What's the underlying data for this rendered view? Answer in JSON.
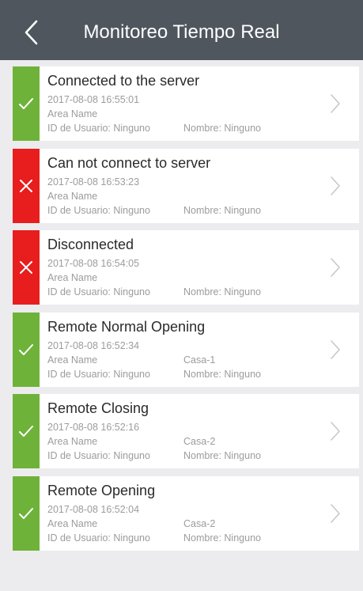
{
  "header": {
    "title": "Monitoreo Tiempo Real"
  },
  "icons": {
    "back": "chevron-left-icon",
    "ok": "check-icon",
    "error": "x-icon",
    "open": "chevron-right-icon"
  },
  "colors": {
    "header_bg": "#4f565e",
    "success": "#6fb23a",
    "error": "#e81d1d",
    "background": "#ececee"
  },
  "events": [
    {
      "status": "ok",
      "title": "Connected to the server",
      "time": "2017-08-08 16:55:01",
      "area_label": "Area Name",
      "area_value": "",
      "user": "ID de Usuario: Ninguno",
      "name": "Nombre: Ninguno"
    },
    {
      "status": "err",
      "title": "Can not connect to server",
      "time": "2017-08-08 16:53:23",
      "area_label": "Area Name",
      "area_value": "",
      "user": "ID de Usuario: Ninguno",
      "name": "Nombre: Ninguno"
    },
    {
      "status": "err",
      "title": "Disconnected",
      "time": "2017-08-08 16:54:05",
      "area_label": "Area Name",
      "area_value": "",
      "user": "ID de Usuario: Ninguno",
      "name": "Nombre: Ninguno"
    },
    {
      "status": "ok",
      "title": "Remote Normal Opening",
      "time": "2017-08-08 16:52:34",
      "area_label": "Area Name",
      "area_value": "Casa-1",
      "user": "ID de Usuario: Ninguno",
      "name": "Nombre: Ninguno"
    },
    {
      "status": "ok",
      "title": "Remote Closing",
      "time": "2017-08-08 16:52:16",
      "area_label": "Area Name",
      "area_value": "Casa-2",
      "user": "ID de Usuario: Ninguno",
      "name": "Nombre: Ninguno"
    },
    {
      "status": "ok",
      "title": "Remote Opening",
      "time": "2017-08-08 16:52:04",
      "area_label": "Area Name",
      "area_value": "Casa-2",
      "user": "ID de Usuario: Ninguno",
      "name": "Nombre: Ninguno"
    }
  ]
}
